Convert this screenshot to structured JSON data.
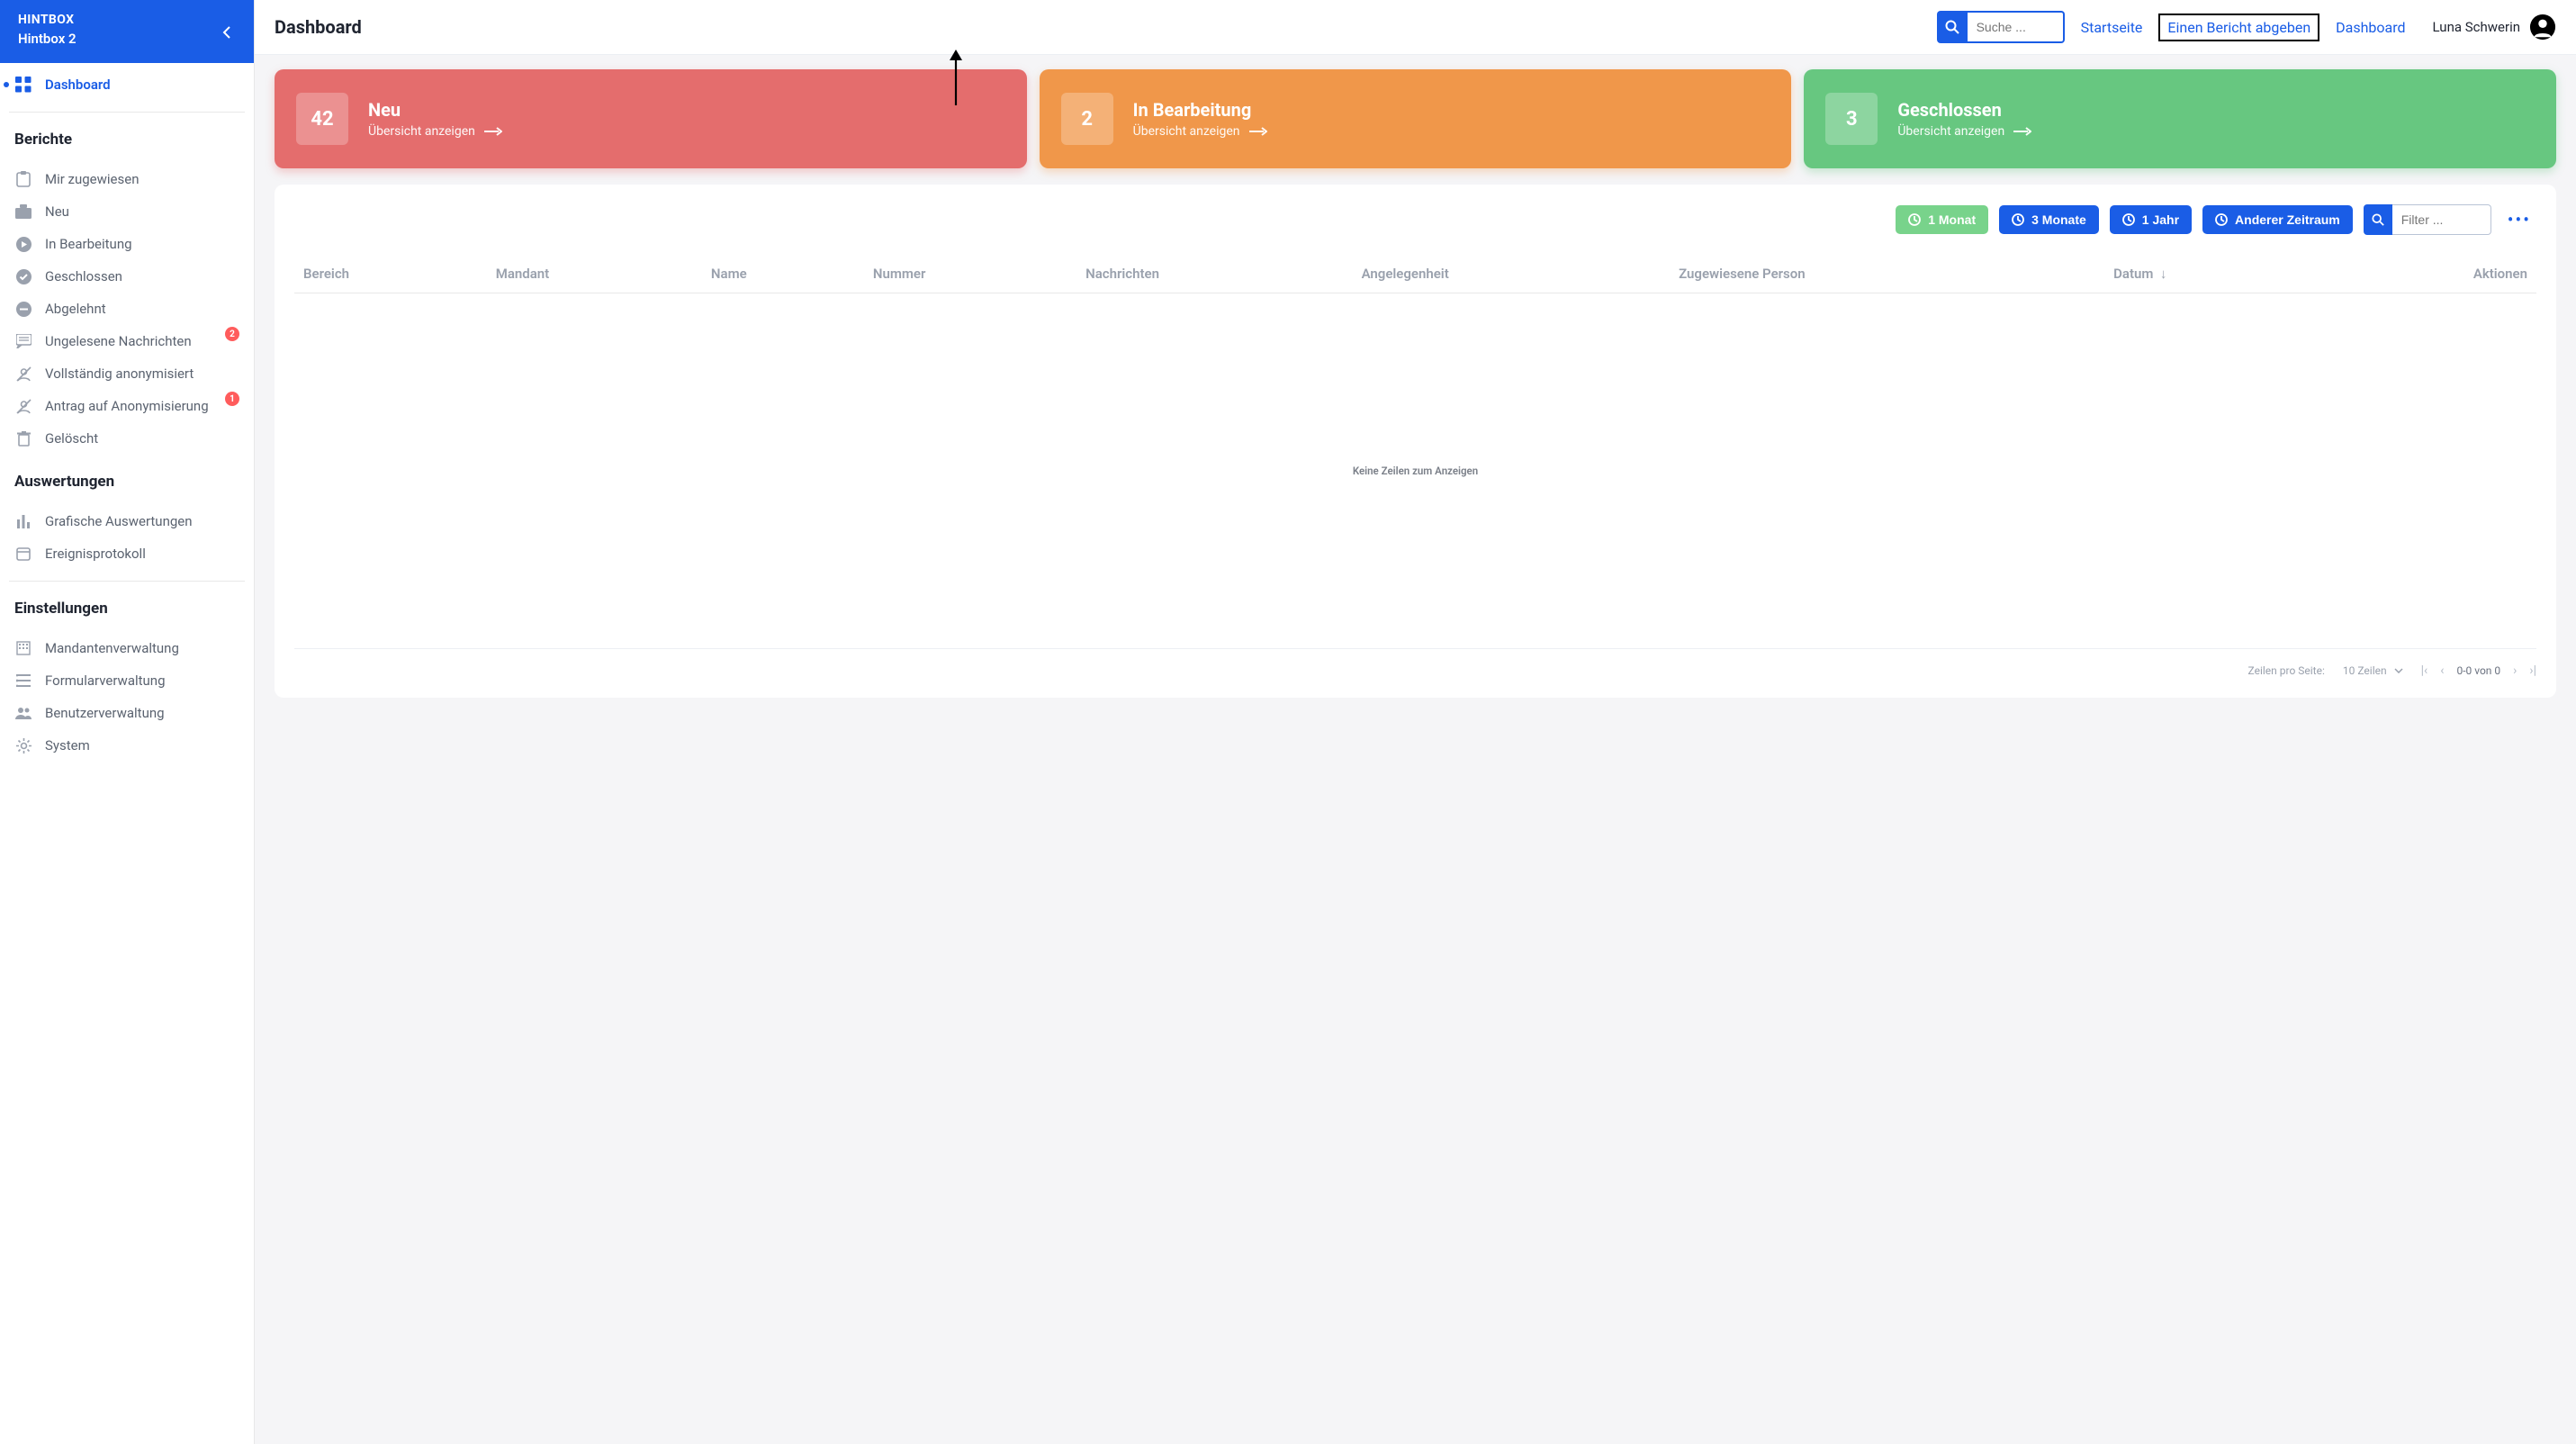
{
  "brand": {
    "name": "HINTBOX",
    "sub": "Hintbox 2"
  },
  "sidebar": {
    "dashboard": "Dashboard",
    "reports_heading": "Berichte",
    "items_reports": [
      {
        "label": "Mir zugewiesen"
      },
      {
        "label": "Neu"
      },
      {
        "label": "In Bearbeitung"
      },
      {
        "label": "Geschlossen"
      },
      {
        "label": "Abgelehnt"
      },
      {
        "label": "Ungelesene Nachrichten",
        "badge": "2"
      },
      {
        "label": "Vollständig anonymisiert"
      },
      {
        "label": "Antrag auf Anonymisierung",
        "badge": "1"
      },
      {
        "label": "Gelöscht"
      }
    ],
    "eval_heading": "Auswertungen",
    "items_eval": [
      {
        "label": "Grafische Auswertungen"
      },
      {
        "label": "Ereignisprotokoll"
      }
    ],
    "settings_heading": "Einstellungen",
    "items_settings": [
      {
        "label": "Mandantenverwaltung"
      },
      {
        "label": "Formularverwaltung"
      },
      {
        "label": "Benutzerverwaltung"
      },
      {
        "label": "System"
      }
    ]
  },
  "topbar": {
    "title": "Dashboard",
    "search_placeholder": "Suche ...",
    "links": {
      "home": "Startseite",
      "report": "Einen Bericht abgeben",
      "dashboard": "Dashboard"
    },
    "user": "Luna Schwerin"
  },
  "cards": {
    "new": {
      "count": "42",
      "title": "Neu",
      "link": "Übersicht anzeigen"
    },
    "processing": {
      "count": "2",
      "title": "In Bearbeitung",
      "link": "Übersicht anzeigen"
    },
    "closed": {
      "count": "3",
      "title": "Geschlossen",
      "link": "Übersicht anzeigen"
    }
  },
  "panel": {
    "range_buttons": {
      "m1": "1 Monat",
      "m3": "3 Monate",
      "y1": "1 Jahr",
      "other": "Anderer Zeitraum"
    },
    "filter_placeholder": "Filter ...",
    "columns": {
      "area": "Bereich",
      "tenant": "Mandant",
      "name": "Name",
      "number": "Nummer",
      "messages": "Nachrichten",
      "matter": "Angelegenheit",
      "assignee": "Zugewiesene Person",
      "date": "Datum",
      "actions": "Aktionen"
    },
    "empty": "Keine Zeilen zum Anzeigen",
    "footer": {
      "rows_label": "Zeilen pro Seite:",
      "rows_value": "10 Zeilen",
      "range": "0-0 von 0"
    }
  }
}
